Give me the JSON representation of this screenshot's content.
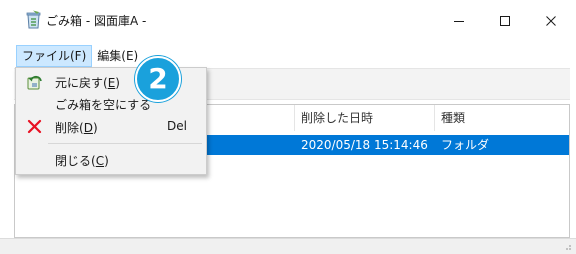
{
  "window": {
    "title": "ごみ箱 - 図面庫A -",
    "app_icon": "recycle-bin-icon",
    "controls": {
      "minimize": "—",
      "maximize": "☐",
      "close": "✕"
    }
  },
  "menubar": {
    "file": "ファイル(F)",
    "edit": "編集(E)"
  },
  "file_menu": {
    "items": [
      {
        "label_pre": "元に戻す(",
        "mnemonic": "E",
        "label_post": ")",
        "icon": "undo-restore-icon",
        "shortcut": ""
      },
      {
        "label": "ごみ箱を空にする",
        "icon": "",
        "shortcut": ""
      },
      {
        "label_pre": "削除(",
        "mnemonic": "D",
        "label_post": ")",
        "icon": "delete-x-icon",
        "shortcut": "Del"
      },
      {
        "label_pre": "閉じる(",
        "mnemonic": "C",
        "label_post": ")",
        "icon": "",
        "shortcut": ""
      }
    ]
  },
  "badge": {
    "number": "2"
  },
  "listview": {
    "columns": [
      "所",
      "削除した日時",
      "種類"
    ],
    "rows": [
      {
        "deleted_at": "2020/05/18 15:14:46",
        "type": "フォルダ"
      }
    ]
  },
  "colors": {
    "selection": "#0078d7",
    "menu_highlight": "#cce8ff",
    "badge": "#1aa1dc",
    "delete_icon": "#e81123"
  }
}
